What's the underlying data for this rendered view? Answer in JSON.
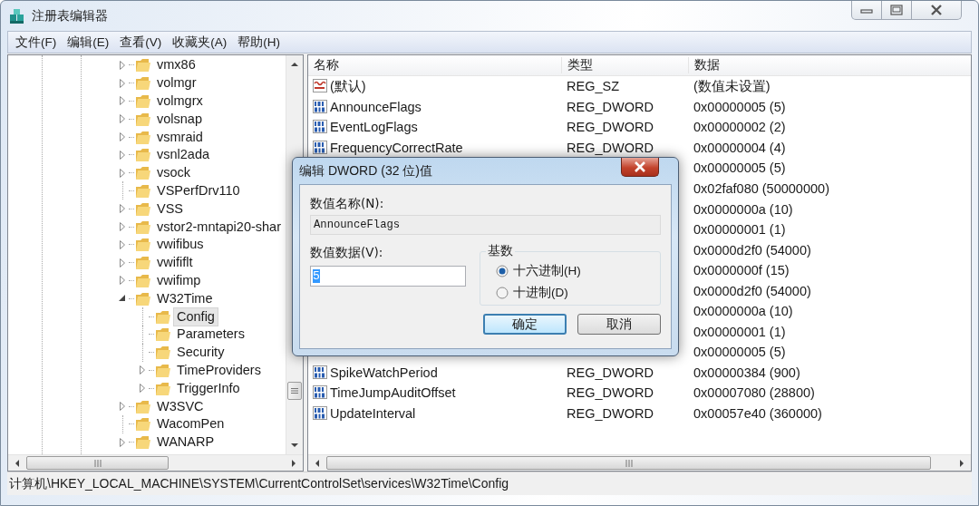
{
  "window": {
    "title": "注册表编辑器"
  },
  "menu": [
    {
      "label": "文件(F)"
    },
    {
      "label": "编辑(E)"
    },
    {
      "label": "查看(V)"
    },
    {
      "label": "收藏夹(A)"
    },
    {
      "label": "帮助(H)"
    }
  ],
  "tree": {
    "items": [
      {
        "label": "vmx86",
        "has_children": true,
        "selected": false
      },
      {
        "label": "volmgr",
        "has_children": true,
        "selected": false
      },
      {
        "label": "volmgrx",
        "has_children": true,
        "selected": false
      },
      {
        "label": "volsnap",
        "has_children": true,
        "selected": false
      },
      {
        "label": "vsmraid",
        "has_children": true,
        "selected": false
      },
      {
        "label": "vsnl2ada",
        "has_children": true,
        "selected": false
      },
      {
        "label": "vsock",
        "has_children": true,
        "selected": false
      },
      {
        "label": "VSPerfDrv110",
        "has_children": false,
        "selected": false
      },
      {
        "label": "VSS",
        "has_children": true,
        "selected": false
      },
      {
        "label": "vstor2-mntapi20-shar",
        "has_children": true,
        "selected": false
      },
      {
        "label": "vwifibus",
        "has_children": true,
        "selected": false
      },
      {
        "label": "vwififlt",
        "has_children": true,
        "selected": false
      },
      {
        "label": "vwifimp",
        "has_children": true,
        "selected": false
      },
      {
        "label": "W32Time",
        "has_children": true,
        "selected": false,
        "children": [
          {
            "label": "Config",
            "has_children": false,
            "selected": true
          },
          {
            "label": "Parameters",
            "has_children": false,
            "selected": false
          },
          {
            "label": "Security",
            "has_children": false,
            "selected": false
          },
          {
            "label": "TimeProviders",
            "has_children": true,
            "selected": false
          },
          {
            "label": "TriggerInfo",
            "has_children": true,
            "selected": false
          }
        ]
      },
      {
        "label": "W3SVC",
        "has_children": true,
        "selected": false
      },
      {
        "label": "WacomPen",
        "has_children": false,
        "selected": false
      },
      {
        "label": "WANARP",
        "has_children": true,
        "selected": false
      }
    ]
  },
  "list": {
    "columns": [
      "名称",
      "类型",
      "数据"
    ],
    "rows": [
      {
        "kind": "string",
        "name": "(默认)",
        "type": "REG_SZ",
        "data": "(数值未设置)"
      },
      {
        "kind": "dword",
        "name": "AnnounceFlags",
        "type": "REG_DWORD",
        "data": "0x00000005 (5)"
      },
      {
        "kind": "dword",
        "name": "EventLogFlags",
        "type": "REG_DWORD",
        "data": "0x00000002 (2)"
      },
      {
        "kind": "dword",
        "name": "FrequencyCorrectRate",
        "type": "REG_DWORD",
        "data": "0x00000004 (4)"
      },
      {
        "data": "0x00000005 (5)"
      },
      {
        "data": "0x02faf080 (50000000)"
      },
      {
        "data": "0x0000000a (10)"
      },
      {
        "data": "0x00000001 (1)"
      },
      {
        "data": "0x0000d2f0 (54000)"
      },
      {
        "data": "0x0000000f (15)"
      },
      {
        "data": "0x0000d2f0 (54000)"
      },
      {
        "data": "0x0000000a (10)"
      },
      {
        "data": "0x00000001 (1)"
      },
      {
        "data": "0x00000005 (5)"
      },
      {
        "kind": "dword",
        "name": "SpikeWatchPeriod",
        "type": "REG_DWORD",
        "data": "0x00000384 (900)"
      },
      {
        "kind": "dword",
        "name": "TimeJumpAuditOffset",
        "type": "REG_DWORD",
        "data": "0x00007080 (28800)"
      },
      {
        "kind": "dword",
        "name": "UpdateInterval",
        "type": "REG_DWORD",
        "data": "0x00057e40 (360000)"
      }
    ]
  },
  "dialog": {
    "title": "编辑 DWORD (32 位)值",
    "name_label": "数值名称(N):",
    "name_value": "AnnounceFlags",
    "data_label": "数值数据(V):",
    "data_value": "5",
    "value_selected": true,
    "base_label": "基数",
    "radios": [
      {
        "label": "十六进制(H)",
        "selected": true
      },
      {
        "label": "十进制(D)",
        "selected": false
      }
    ],
    "buttons": [
      {
        "label": "确定",
        "default": true
      },
      {
        "label": "取消",
        "default": false
      }
    ]
  },
  "status_bar": "计算机\\HKEY_LOCAL_MACHINE\\SYSTEM\\CurrentControlSet\\services\\W32Time\\Config"
}
